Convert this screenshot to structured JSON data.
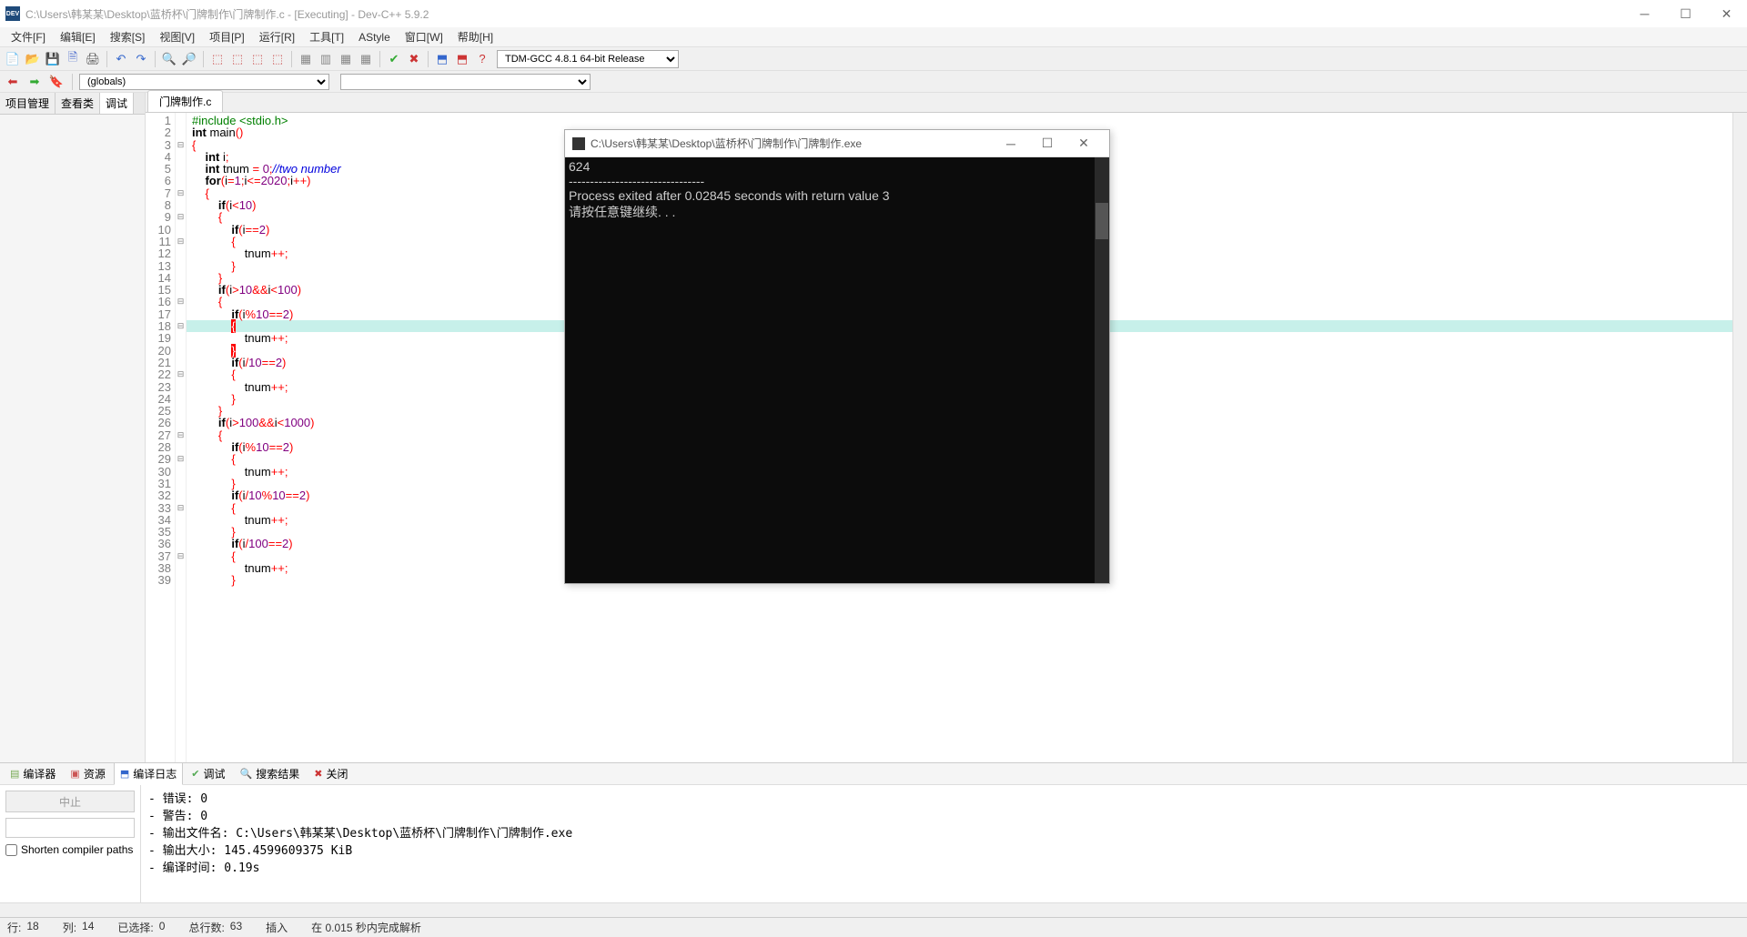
{
  "window": {
    "title": "C:\\Users\\韩某某\\Desktop\\蓝桥杯\\门牌制作\\门牌制作.c - [Executing] - Dev-C++ 5.9.2",
    "app_icon_text": "DEV"
  },
  "menus": [
    "文件[F]",
    "编辑[E]",
    "搜索[S]",
    "视图[V]",
    "项目[P]",
    "运行[R]",
    "工具[T]",
    "AStyle",
    "窗口[W]",
    "帮助[H]"
  ],
  "compiler_selected": "TDM-GCC 4.8.1 64-bit Release",
  "globals_selected": "(globals)",
  "left_tabs": [
    "项目管理",
    "查看类",
    "调试"
  ],
  "left_tab_active": 2,
  "editor_tab": "门牌制作.c",
  "code_lines": [
    {
      "n": 1,
      "f": "",
      "t": [
        {
          "c": "pp",
          "s": "#include <stdio.h>"
        }
      ]
    },
    {
      "n": 2,
      "f": "",
      "t": [
        {
          "c": "kw",
          "s": "int"
        },
        {
          "c": "",
          "s": " main"
        },
        {
          "c": "op",
          "s": "()"
        }
      ]
    },
    {
      "n": 3,
      "f": "⊟",
      "t": [
        {
          "c": "op",
          "s": "{"
        }
      ]
    },
    {
      "n": 4,
      "f": "",
      "t": [
        {
          "c": "",
          "s": "    "
        },
        {
          "c": "kw",
          "s": "int"
        },
        {
          "c": "",
          "s": " i"
        },
        {
          "c": "op",
          "s": ";"
        }
      ]
    },
    {
      "n": 5,
      "f": "",
      "t": [
        {
          "c": "",
          "s": "    "
        },
        {
          "c": "kw",
          "s": "int"
        },
        {
          "c": "",
          "s": " tnum "
        },
        {
          "c": "op",
          "s": "="
        },
        {
          "c": "",
          "s": " "
        },
        {
          "c": "num",
          "s": "0"
        },
        {
          "c": "op",
          "s": ";"
        },
        {
          "c": "cmt",
          "s": "//two number"
        }
      ]
    },
    {
      "n": 6,
      "f": "",
      "t": [
        {
          "c": "",
          "s": "    "
        },
        {
          "c": "kw",
          "s": "for"
        },
        {
          "c": "op",
          "s": "("
        },
        {
          "c": "",
          "s": "i"
        },
        {
          "c": "op",
          "s": "="
        },
        {
          "c": "num",
          "s": "1"
        },
        {
          "c": "op",
          "s": ";"
        },
        {
          "c": "",
          "s": "i"
        },
        {
          "c": "op",
          "s": "<="
        },
        {
          "c": "num",
          "s": "2020"
        },
        {
          "c": "op",
          "s": ";"
        },
        {
          "c": "",
          "s": "i"
        },
        {
          "c": "op",
          "s": "++)"
        }
      ]
    },
    {
      "n": 7,
      "f": "⊟",
      "t": [
        {
          "c": "",
          "s": "    "
        },
        {
          "c": "op",
          "s": "{"
        }
      ]
    },
    {
      "n": 8,
      "f": "",
      "t": [
        {
          "c": "",
          "s": "        "
        },
        {
          "c": "kw",
          "s": "if"
        },
        {
          "c": "op",
          "s": "("
        },
        {
          "c": "",
          "s": "i"
        },
        {
          "c": "op",
          "s": "<"
        },
        {
          "c": "num",
          "s": "10"
        },
        {
          "c": "op",
          "s": ")"
        }
      ]
    },
    {
      "n": 9,
      "f": "⊟",
      "t": [
        {
          "c": "",
          "s": "        "
        },
        {
          "c": "op",
          "s": "{"
        }
      ]
    },
    {
      "n": 10,
      "f": "",
      "t": [
        {
          "c": "",
          "s": "            "
        },
        {
          "c": "kw",
          "s": "if"
        },
        {
          "c": "op",
          "s": "("
        },
        {
          "c": "",
          "s": "i"
        },
        {
          "c": "op",
          "s": "=="
        },
        {
          "c": "num",
          "s": "2"
        },
        {
          "c": "op",
          "s": ")"
        }
      ]
    },
    {
      "n": 11,
      "f": "⊟",
      "t": [
        {
          "c": "",
          "s": "            "
        },
        {
          "c": "op",
          "s": "{"
        }
      ]
    },
    {
      "n": 12,
      "f": "",
      "t": [
        {
          "c": "",
          "s": "                tnum"
        },
        {
          "c": "op",
          "s": "++;"
        }
      ]
    },
    {
      "n": 13,
      "f": "",
      "t": [
        {
          "c": "",
          "s": "            "
        },
        {
          "c": "op",
          "s": "}"
        }
      ]
    },
    {
      "n": 14,
      "f": "",
      "t": [
        {
          "c": "",
          "s": "        "
        },
        {
          "c": "op",
          "s": "}"
        }
      ]
    },
    {
      "n": 15,
      "f": "",
      "t": [
        {
          "c": "",
          "s": "        "
        },
        {
          "c": "kw",
          "s": "if"
        },
        {
          "c": "op",
          "s": "("
        },
        {
          "c": "",
          "s": "i"
        },
        {
          "c": "op",
          "s": ">"
        },
        {
          "c": "num",
          "s": "10"
        },
        {
          "c": "op",
          "s": "&&"
        },
        {
          "c": "",
          "s": "i"
        },
        {
          "c": "op",
          "s": "<"
        },
        {
          "c": "num",
          "s": "100"
        },
        {
          "c": "op",
          "s": ")"
        }
      ]
    },
    {
      "n": 16,
      "f": "⊟",
      "t": [
        {
          "c": "",
          "s": "        "
        },
        {
          "c": "op",
          "s": "{"
        }
      ]
    },
    {
      "n": 17,
      "f": "",
      "t": [
        {
          "c": "",
          "s": "            "
        },
        {
          "c": "kw",
          "s": "if"
        },
        {
          "c": "op",
          "s": "("
        },
        {
          "c": "",
          "s": "i"
        },
        {
          "c": "op",
          "s": "%"
        },
        {
          "c": "num",
          "s": "10"
        },
        {
          "c": "op",
          "s": "=="
        },
        {
          "c": "num",
          "s": "2"
        },
        {
          "c": "op",
          "s": ")"
        }
      ]
    },
    {
      "n": 18,
      "f": "⊟",
      "t": [
        {
          "c": "",
          "s": "            "
        },
        {
          "c": "brace-hl",
          "s": "{"
        }
      ]
    },
    {
      "n": 19,
      "f": "",
      "t": [
        {
          "c": "",
          "s": "                tnum"
        },
        {
          "c": "op",
          "s": "++;"
        }
      ]
    },
    {
      "n": 20,
      "f": "",
      "t": [
        {
          "c": "",
          "s": "            "
        },
        {
          "c": "brace-hl",
          "s": "}"
        }
      ]
    },
    {
      "n": 21,
      "f": "",
      "t": [
        {
          "c": "",
          "s": "            "
        },
        {
          "c": "kw",
          "s": "if"
        },
        {
          "c": "op",
          "s": "("
        },
        {
          "c": "",
          "s": "i"
        },
        {
          "c": "op",
          "s": "/"
        },
        {
          "c": "num",
          "s": "10"
        },
        {
          "c": "op",
          "s": "=="
        },
        {
          "c": "num",
          "s": "2"
        },
        {
          "c": "op",
          "s": ")"
        }
      ]
    },
    {
      "n": 22,
      "f": "⊟",
      "t": [
        {
          "c": "",
          "s": "            "
        },
        {
          "c": "op",
          "s": "{"
        }
      ]
    },
    {
      "n": 23,
      "f": "",
      "t": [
        {
          "c": "",
          "s": "                tnum"
        },
        {
          "c": "op",
          "s": "++;"
        }
      ]
    },
    {
      "n": 24,
      "f": "",
      "t": [
        {
          "c": "",
          "s": "            "
        },
        {
          "c": "op",
          "s": "}"
        }
      ]
    },
    {
      "n": 25,
      "f": "",
      "t": [
        {
          "c": "",
          "s": "        "
        },
        {
          "c": "op",
          "s": "}"
        }
      ]
    },
    {
      "n": 26,
      "f": "",
      "t": [
        {
          "c": "",
          "s": "        "
        },
        {
          "c": "kw",
          "s": "if"
        },
        {
          "c": "op",
          "s": "("
        },
        {
          "c": "",
          "s": "i"
        },
        {
          "c": "op",
          "s": ">"
        },
        {
          "c": "num",
          "s": "100"
        },
        {
          "c": "op",
          "s": "&&"
        },
        {
          "c": "",
          "s": "i"
        },
        {
          "c": "op",
          "s": "<"
        },
        {
          "c": "num",
          "s": "1000"
        },
        {
          "c": "op",
          "s": ")"
        }
      ]
    },
    {
      "n": 27,
      "f": "⊟",
      "t": [
        {
          "c": "",
          "s": "        "
        },
        {
          "c": "op",
          "s": "{"
        }
      ]
    },
    {
      "n": 28,
      "f": "",
      "t": [
        {
          "c": "",
          "s": "            "
        },
        {
          "c": "kw",
          "s": "if"
        },
        {
          "c": "op",
          "s": "("
        },
        {
          "c": "",
          "s": "i"
        },
        {
          "c": "op",
          "s": "%"
        },
        {
          "c": "num",
          "s": "10"
        },
        {
          "c": "op",
          "s": "=="
        },
        {
          "c": "num",
          "s": "2"
        },
        {
          "c": "op",
          "s": ")"
        }
      ]
    },
    {
      "n": 29,
      "f": "⊟",
      "t": [
        {
          "c": "",
          "s": "            "
        },
        {
          "c": "op",
          "s": "{"
        }
      ]
    },
    {
      "n": 30,
      "f": "",
      "t": [
        {
          "c": "",
          "s": "                tnum"
        },
        {
          "c": "op",
          "s": "++;"
        }
      ]
    },
    {
      "n": 31,
      "f": "",
      "t": [
        {
          "c": "",
          "s": "            "
        },
        {
          "c": "op",
          "s": "}"
        }
      ]
    },
    {
      "n": 32,
      "f": "",
      "t": [
        {
          "c": "",
          "s": "            "
        },
        {
          "c": "kw",
          "s": "if"
        },
        {
          "c": "op",
          "s": "("
        },
        {
          "c": "",
          "s": "i"
        },
        {
          "c": "op",
          "s": "/"
        },
        {
          "c": "num",
          "s": "10"
        },
        {
          "c": "op",
          "s": "%"
        },
        {
          "c": "num",
          "s": "10"
        },
        {
          "c": "op",
          "s": "=="
        },
        {
          "c": "num",
          "s": "2"
        },
        {
          "c": "op",
          "s": ")"
        }
      ]
    },
    {
      "n": 33,
      "f": "⊟",
      "t": [
        {
          "c": "",
          "s": "            "
        },
        {
          "c": "op",
          "s": "{"
        }
      ]
    },
    {
      "n": 34,
      "f": "",
      "t": [
        {
          "c": "",
          "s": "                tnum"
        },
        {
          "c": "op",
          "s": "++;"
        }
      ]
    },
    {
      "n": 35,
      "f": "",
      "t": [
        {
          "c": "",
          "s": "            "
        },
        {
          "c": "op",
          "s": "}"
        }
      ]
    },
    {
      "n": 36,
      "f": "",
      "t": [
        {
          "c": "",
          "s": "            "
        },
        {
          "c": "kw",
          "s": "if"
        },
        {
          "c": "op",
          "s": "("
        },
        {
          "c": "",
          "s": "i"
        },
        {
          "c": "op",
          "s": "/"
        },
        {
          "c": "num",
          "s": "100"
        },
        {
          "c": "op",
          "s": "=="
        },
        {
          "c": "num",
          "s": "2"
        },
        {
          "c": "op",
          "s": ")"
        }
      ]
    },
    {
      "n": 37,
      "f": "⊟",
      "t": [
        {
          "c": "",
          "s": "            "
        },
        {
          "c": "op",
          "s": "{"
        }
      ]
    },
    {
      "n": 38,
      "f": "",
      "t": [
        {
          "c": "",
          "s": "                tnum"
        },
        {
          "c": "op",
          "s": "++;"
        }
      ]
    },
    {
      "n": 39,
      "f": "",
      "t": [
        {
          "c": "",
          "s": "            "
        },
        {
          "c": "op",
          "s": "}"
        }
      ]
    }
  ],
  "highlight_line_index": 17,
  "console": {
    "title": "C:\\Users\\韩某某\\Desktop\\蓝桥杯\\门牌制作\\门牌制作.exe",
    "lines": [
      "624",
      "--------------------------------",
      "Process exited after 0.02845 seconds with return value 3",
      "请按任意键继续. . ."
    ]
  },
  "bottom_tabs": [
    {
      "icon": "▤",
      "label": "编译器",
      "color": "#7a5"
    },
    {
      "icon": "▣",
      "label": "资源",
      "color": "#c55"
    },
    {
      "icon": "⬒",
      "label": "编译日志",
      "color": "#36c"
    },
    {
      "icon": "✔",
      "label": "调试",
      "color": "#5a5"
    },
    {
      "icon": "🔍",
      "label": "搜索结果",
      "color": "#888"
    },
    {
      "icon": "✖",
      "label": "关闭",
      "color": "#c33"
    }
  ],
  "bottom_tab_active": 2,
  "bottom_left": {
    "abort": "中止",
    "shorten": "Shorten compiler paths"
  },
  "compile_log": "- 错误: 0\n- 警告: 0\n- 输出文件名: C:\\Users\\韩某某\\Desktop\\蓝桥杯\\门牌制作\\门牌制作.exe\n- 输出大小: 145.4599609375 KiB\n- 编译时间: 0.19s",
  "statusbar": {
    "line_label": "行:",
    "line_val": "18",
    "col_label": "列:",
    "col_val": "14",
    "sel_label": "已选择:",
    "sel_val": "0",
    "total_label": "总行数:",
    "total_val": "63",
    "mode": "插入",
    "parse": "在 0.015 秒内完成解析"
  },
  "toolbar_icons": [
    "📄",
    "📂",
    "💾",
    "🗎",
    "🖨",
    "↶",
    "↷",
    "🔍",
    "🔎",
    "⬚",
    "⬚",
    "⬚",
    "⬚",
    "▦",
    "▥",
    "▦",
    "▦",
    "✔",
    "✖",
    "⬒",
    "⬒",
    "?"
  ]
}
